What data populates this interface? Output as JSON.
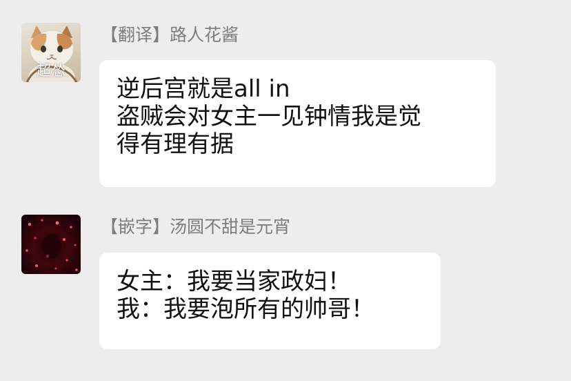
{
  "messages": [
    {
      "sender": "【翻译】路人花酱",
      "avatar_icon": "cat-avatar-icon",
      "avatar_caption": "超怂",
      "lines": [
        "逆后宫就是all in",
        "盗贼会对女主一见钟情我是觉",
        "得有理有据"
      ]
    },
    {
      "sender": "【嵌字】汤圆不甜是元宵",
      "avatar_icon": "dark-red-lights-avatar-icon",
      "lines": [
        "女主：我要当家政妇！",
        "我：我要泡所有的帅哥！"
      ]
    }
  ],
  "colors": {
    "background": "#ededed",
    "bubble": "#ffffff",
    "sender_text": "#7d7d7d",
    "message_text": "#111111"
  }
}
